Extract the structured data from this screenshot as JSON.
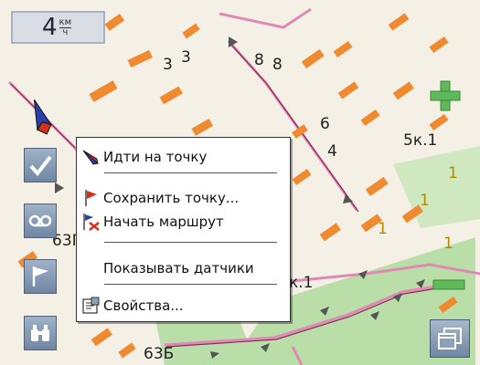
{
  "speed": {
    "value": "4",
    "unit_top": "км",
    "unit_bottom": "ч"
  },
  "map_labels": [
    {
      "text": "3",
      "color": "dark"
    },
    {
      "text": "3",
      "color": "dark"
    },
    {
      "text": "8",
      "color": "dark"
    },
    {
      "text": "8",
      "color": "dark"
    },
    {
      "text": "6",
      "color": "dark"
    },
    {
      "text": "4",
      "color": "dark"
    },
    {
      "text": "5к.1",
      "color": "dark"
    },
    {
      "text": "1",
      "color": "yellow"
    },
    {
      "text": "1",
      "color": "yellow"
    },
    {
      "text": "1",
      "color": "yellow"
    },
    {
      "text": "1",
      "color": "yellow"
    },
    {
      "text": "63Г",
      "color": "dark"
    },
    {
      "text": "к.1",
      "color": "dark"
    },
    {
      "text": "63Б",
      "color": "dark"
    }
  ],
  "context_menu": {
    "items": [
      {
        "label": "Идти на точку",
        "icon": "compass-arrow-icon"
      },
      {
        "label": "Сохранить точку...",
        "icon": "red-flag-icon"
      },
      {
        "label": "Начать маршрут",
        "icon": "route-icon"
      },
      {
        "label": "Показывать датчики",
        "icon": ""
      },
      {
        "label": "Свойства...",
        "icon": "properties-icon"
      }
    ]
  },
  "side_buttons": [
    {
      "icon": "checkmark-icon"
    },
    {
      "icon": "cassette-icon"
    },
    {
      "icon": "flag-icon"
    },
    {
      "icon": "binoculars-icon"
    }
  ],
  "colors": {
    "map_bg": "#f4f0e6",
    "building": "#f08a30",
    "road_pink": "#e089b4",
    "park": "#b9dea8",
    "zoom_green": "#5fb85a"
  }
}
